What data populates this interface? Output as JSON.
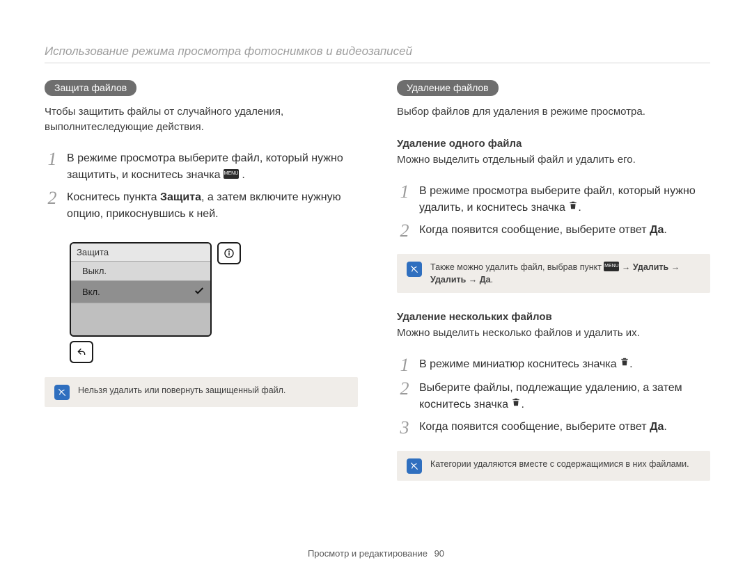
{
  "header": {
    "title": "Использование режима просмотра фотоснимков и видеозаписей"
  },
  "left": {
    "pill": "Защита файлов",
    "intro": "Чтобы защитить файлы от случайного удаления, выполнитеследующие действия.",
    "steps": [
      {
        "pre": "В режиме просмотра выберите файл, который нужно защитить, и коснитесь значка ",
        "chip": "MENU",
        "post": "."
      },
      {
        "pre": "Коснитесь пункта ",
        "bold": "Защита",
        "post": ", а затем включите нужную опцию, прикоснувшись к ней."
      }
    ],
    "screen": {
      "title": "Защита",
      "off": "Выкл.",
      "on": "Вкл."
    },
    "note": "Нельзя удалить или повернуть защищенный файл."
  },
  "right": {
    "pill": "Удаление файлов",
    "intro": "Выбор файлов для удаления в режиме просмотра.",
    "section1": {
      "head": "Удаление одного файла",
      "lead": "Можно выделить отдельный файл и удалить его.",
      "steps": [
        {
          "pre": "В режиме просмотра выберите файл, который нужно удалить, и коснитесь значка ",
          "icon": "trash",
          "post": "."
        },
        {
          "pre": "Когда появится сообщение, выберите ответ ",
          "bold": "Да",
          "post": "."
        }
      ],
      "note": {
        "pre": "Также можно удалить файл, выбрав пункт ",
        "chip": "MENU",
        "mid": " → ",
        "b1": "Удалить",
        "arrow2": " → ",
        "b2": "Удалить",
        "arrow3": " → ",
        "b3": "Да",
        "post": "."
      }
    },
    "section2": {
      "head": "Удаление нескольких файлов",
      "lead": "Можно выделить несколько файлов и удалить их.",
      "steps": [
        {
          "pre": "В режиме миниатюр коснитесь значка ",
          "icon": "trash",
          "post": "."
        },
        {
          "pre": "Выберите файлы, подлежащие удалению, а затем коснитесь значка ",
          "icon": "trash",
          "post": "."
        },
        {
          "pre": "Когда появится сообщение, выберите ответ ",
          "bold": "Да",
          "post": "."
        }
      ],
      "note": "Категории удаляются вместе с содержащимися в них файлами."
    }
  },
  "footer": {
    "section": "Просмотр и редактирование",
    "page": "90"
  }
}
